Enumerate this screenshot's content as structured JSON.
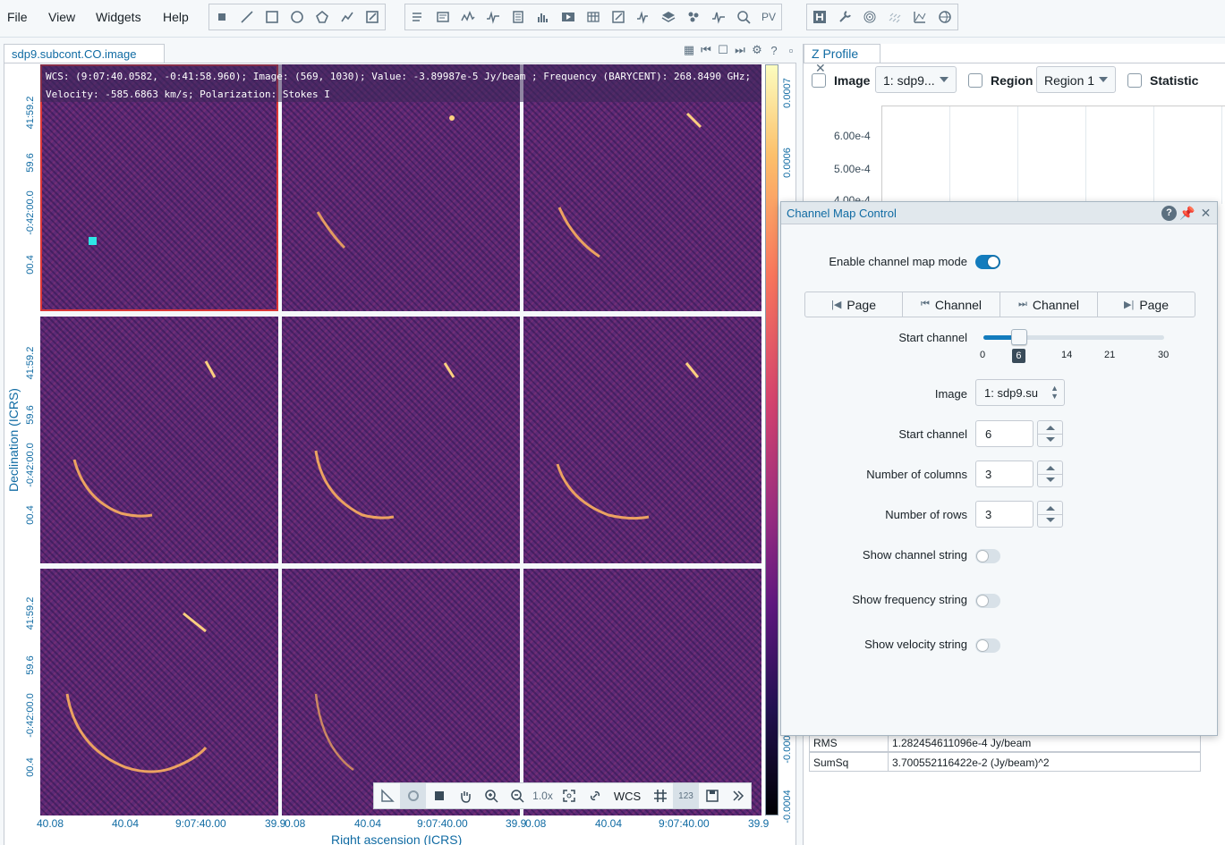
{
  "menu": {
    "items": [
      "File",
      "View",
      "Widgets",
      "Help"
    ]
  },
  "toolbar": {
    "pv_label": "PV"
  },
  "image_view": {
    "tab_title": "sdp9.subcont.CO.image",
    "info_line1": "WCS: (9:07:40.0582, -0:41:58.960); Image: (569, 1030); Value: -3.89987e-5 Jy/beam ; Frequency (BARYCENT): 268.8490 GHz;",
    "info_line2": "Velocity: -585.6863 km/s; Polarization: Stokes I",
    "y_axis_label": "Declination (ICRS)",
    "x_axis_label": "Right ascension (ICRS)",
    "y_ticks": [
      "41:59.2",
      "59.6",
      "-0:42:00.0",
      "00.4"
    ],
    "x_ticks_left": [
      "40.08",
      "40.04",
      "9:07:40.00",
      "39.9"
    ],
    "x_ticks_right": [
      "0.08",
      "40.04",
      "9:07:40.00",
      "39.9"
    ],
    "colorbar_ticks": [
      "0.0007",
      "0.0006",
      "-0.000",
      "-0.0004"
    ],
    "zoom_label": "1.0x",
    "wcs_label": "WCS",
    "num_label": "123"
  },
  "z_profile": {
    "tab_title": "Z Profile",
    "image_label": "Image",
    "image_select": "1: sdp9...",
    "region_label": "Region",
    "region_select": "Region 1",
    "statistic_label": "Statistic",
    "y_ticks": [
      "6.00e-4",
      "5.00e-4",
      "4.00e-4"
    ],
    "stats": [
      {
        "name": "RMS",
        "value": "1.282454611096e-4 Jy/beam"
      },
      {
        "name": "SumSq",
        "value": "3.700552116422e-2 (Jy/beam)^2"
      }
    ]
  },
  "channel_map": {
    "title": "Channel Map Control",
    "enable_label": "Enable channel map mode",
    "enabled": true,
    "pager": [
      "Page",
      "Channel",
      "Channel",
      "Page"
    ],
    "start_channel_label": "Start channel",
    "slider": {
      "min": 0,
      "max": 30,
      "value": 6,
      "ticks": [
        "0",
        "14",
        "21",
        "30"
      ],
      "value_label": "6"
    },
    "image_label": "Image",
    "image_select": "1: sdp9.su",
    "start_channel_input_label": "Start channel",
    "start_channel_value": "6",
    "columns_label": "Number of columns",
    "columns_value": "3",
    "rows_label": "Number of rows",
    "rows_value": "3",
    "show_channel_label": "Show channel string",
    "show_frequency_label": "Show frequency string",
    "show_velocity_label": "Show velocity string"
  }
}
